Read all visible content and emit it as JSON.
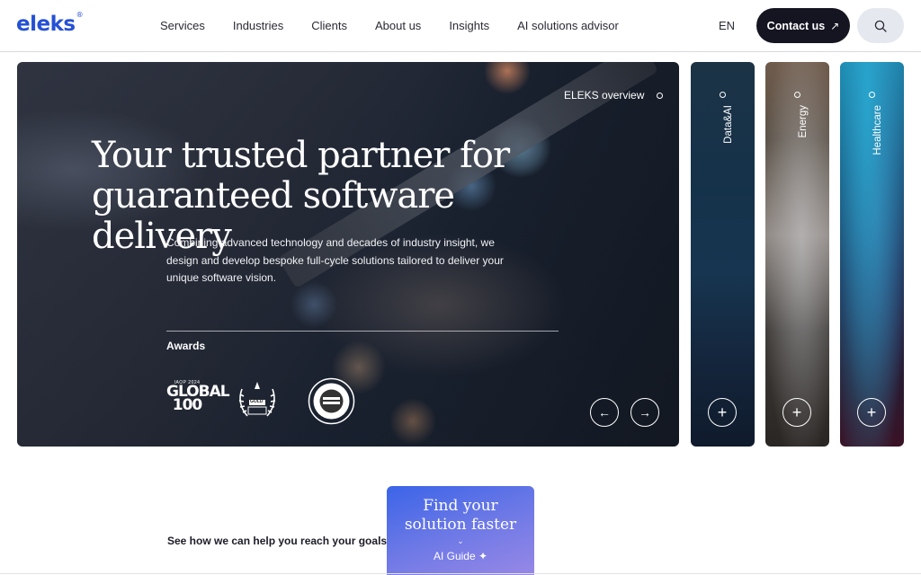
{
  "header": {
    "logo": "eleks",
    "logo_mark": "®",
    "nav": [
      "Services",
      "Industries",
      "Clients",
      "About us",
      "Insights",
      "AI solutions advisor"
    ],
    "lang": "EN",
    "contact_label": "Contact us",
    "contact_icon": "arrow-up-right-icon",
    "search_icon": "search-icon"
  },
  "hero": {
    "overview_label": "ELEKS overview",
    "title_line1": "Your trusted partner for",
    "title_line2": "guaranteed software delivery",
    "description": "Combining advanced technology and decades of industry insight, we design and develop bespoke full-cycle solutions tailored to deliver your unique software vision.",
    "awards_label": "Awards",
    "awards": [
      {
        "icon": "iaop-global-100-badge",
        "small": "IAOP 2024",
        "big1": "GLOBAL",
        "big2": "100"
      },
      {
        "icon": "gold-award-laurel-badge",
        "text": "GOLD"
      },
      {
        "icon": "round-seal-award-badge"
      }
    ],
    "prev_icon": "arrow-left-icon",
    "next_icon": "arrow-right-icon"
  },
  "side_cards": [
    {
      "label": "Data&AI",
      "icon": "plus-icon"
    },
    {
      "label": "Energy",
      "icon": "plus-icon"
    },
    {
      "label": "Healthcare",
      "icon": "plus-icon"
    }
  ],
  "bottom": {
    "goals_text": "See how we can help you reach your goals",
    "ai_title_line1": "Find your",
    "ai_title_line2": "solution faster",
    "ai_chevron": "⌄",
    "ai_guide": "AI Guide",
    "ai_sparkle": "✦"
  },
  "colors": {
    "brand": "#2551d4",
    "contact_bg": "#151522",
    "search_bg": "#e6e8f0",
    "ai_gradient_start": "#3b64e8",
    "ai_gradient_end": "#9d8ae6"
  }
}
